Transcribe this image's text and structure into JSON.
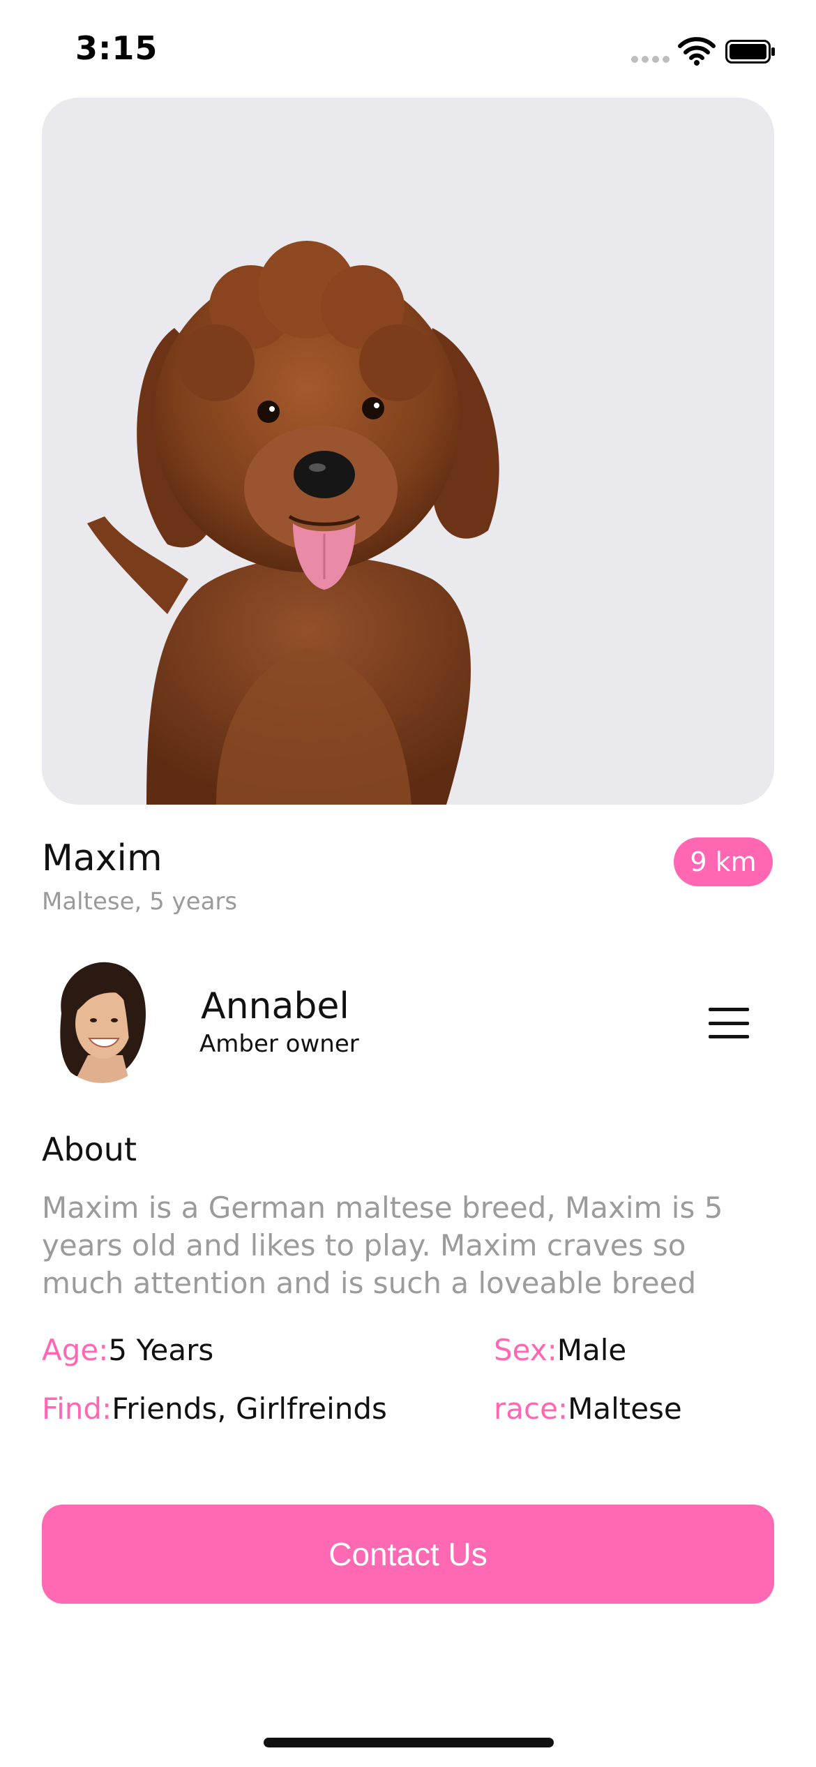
{
  "status_bar": {
    "time": "3:15"
  },
  "pet": {
    "name": "Maxim",
    "subtitle": "Maltese, 5 years",
    "distance": "9 km"
  },
  "owner": {
    "name": "Annabel",
    "role": "Amber owner"
  },
  "about": {
    "heading": "About",
    "text": "Maxim is a German maltese breed, Maxim is 5 years old and likes to play. Maxim craves so much attention and is such a loveable breed"
  },
  "details": {
    "age_label": "Age:",
    "age_value": "5 Years",
    "sex_label": "Sex:",
    "sex_value": "Male",
    "find_label": "Find:",
    "find_value": "Friends, Girlfreinds",
    "race_label": "race:",
    "race_value": "Maltese"
  },
  "actions": {
    "contact_label": "Contact Us"
  },
  "colors": {
    "accent": "#ff69b4",
    "muted_text": "#9b9b9b",
    "photo_background": "#e9e9ee"
  }
}
